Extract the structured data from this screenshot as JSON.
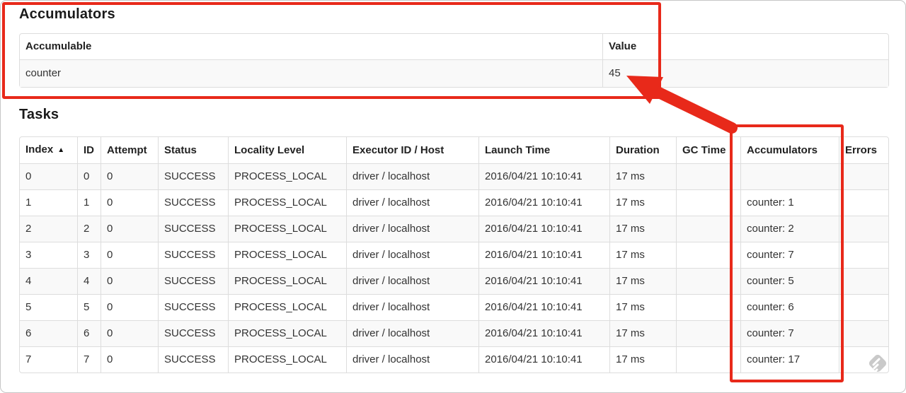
{
  "accumulators_section": {
    "title": "Accumulators",
    "table": {
      "headers": {
        "accumulable": "Accumulable",
        "value": "Value"
      },
      "row": {
        "accumulable": "counter",
        "value": "45"
      }
    }
  },
  "tasks_section": {
    "title": "Tasks",
    "table": {
      "headers": [
        "Index",
        "ID",
        "Attempt",
        "Status",
        "Locality Level",
        "Executor ID / Host",
        "Launch Time",
        "Duration",
        "GC Time",
        "Accumulators",
        "Errors"
      ],
      "sort_icon": "▲",
      "rows": [
        {
          "index": "0",
          "id": "0",
          "attempt": "0",
          "status": "SUCCESS",
          "locality_level": "PROCESS_LOCAL",
          "executor_id_host": "driver / localhost",
          "launch_time": "2016/04/21 10:10:41",
          "duration": "17 ms",
          "gc_time": "",
          "accumulators": "",
          "errors": ""
        },
        {
          "index": "1",
          "id": "1",
          "attempt": "0",
          "status": "SUCCESS",
          "locality_level": "PROCESS_LOCAL",
          "executor_id_host": "driver / localhost",
          "launch_time": "2016/04/21 10:10:41",
          "duration": "17 ms",
          "gc_time": "",
          "accumulators": "counter: 1",
          "errors": ""
        },
        {
          "index": "2",
          "id": "2",
          "attempt": "0",
          "status": "SUCCESS",
          "locality_level": "PROCESS_LOCAL",
          "executor_id_host": "driver / localhost",
          "launch_time": "2016/04/21 10:10:41",
          "duration": "17 ms",
          "gc_time": "",
          "accumulators": "counter: 2",
          "errors": ""
        },
        {
          "index": "3",
          "id": "3",
          "attempt": "0",
          "status": "SUCCESS",
          "locality_level": "PROCESS_LOCAL",
          "executor_id_host": "driver / localhost",
          "launch_time": "2016/04/21 10:10:41",
          "duration": "17 ms",
          "gc_time": "",
          "accumulators": "counter: 7",
          "errors": ""
        },
        {
          "index": "4",
          "id": "4",
          "attempt": "0",
          "status": "SUCCESS",
          "locality_level": "PROCESS_LOCAL",
          "executor_id_host": "driver / localhost",
          "launch_time": "2016/04/21 10:10:41",
          "duration": "17 ms",
          "gc_time": "",
          "accumulators": "counter: 5",
          "errors": ""
        },
        {
          "index": "5",
          "id": "5",
          "attempt": "0",
          "status": "SUCCESS",
          "locality_level": "PROCESS_LOCAL",
          "executor_id_host": "driver / localhost",
          "launch_time": "2016/04/21 10:10:41",
          "duration": "17 ms",
          "gc_time": "",
          "accumulators": "counter: 6",
          "errors": ""
        },
        {
          "index": "6",
          "id": "6",
          "attempt": "0",
          "status": "SUCCESS",
          "locality_level": "PROCESS_LOCAL",
          "executor_id_host": "driver / localhost",
          "launch_time": "2016/04/21 10:10:41",
          "duration": "17 ms",
          "gc_time": "",
          "accumulators": "counter: 7",
          "errors": ""
        },
        {
          "index": "7",
          "id": "7",
          "attempt": "0",
          "status": "SUCCESS",
          "locality_level": "PROCESS_LOCAL",
          "executor_id_host": "driver / localhost",
          "launch_time": "2016/04/21 10:10:41",
          "duration": "17 ms",
          "gc_time": "",
          "accumulators": "counter: 17",
          "errors": ""
        }
      ]
    }
  },
  "annotations": {
    "highlight_color": "#e8291a",
    "boxed_regions": [
      "accumulators-section",
      "accumulators-column"
    ],
    "arrow_target": "value 45"
  },
  "icons": {
    "sort_ascending": "▲",
    "watermark": "feedly-icon"
  }
}
